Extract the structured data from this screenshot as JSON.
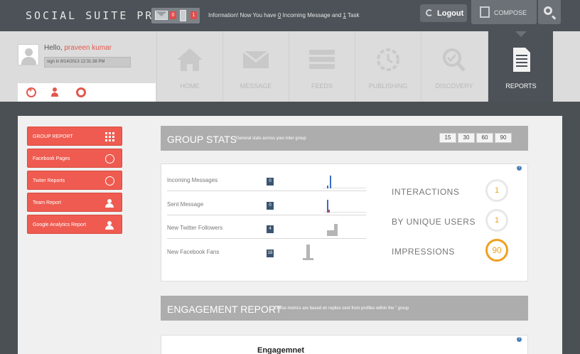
{
  "app": {
    "logo_text": "SOCIAL SUITE PRO",
    "notifications": {
      "messages_count": "0",
      "tasks_count": "1"
    },
    "info": {
      "prefix": "Information! Now You have ",
      "messages": "0",
      "middle": " Incoming Message and ",
      "tasks": "1",
      "suffix": " Task"
    },
    "logout_label": "Logout",
    "compose_label": "COMPOSE"
  },
  "user": {
    "greeting": "Hello, ",
    "name": "praveen kumar",
    "signin": "sign in  8/14/2013 12:31:38 PM"
  },
  "nav": [
    {
      "label": "HOME",
      "icon": "home-icon"
    },
    {
      "label": "MESSAGE",
      "icon": "envelope-icon"
    },
    {
      "label": "FEEDS",
      "icon": "list-icon"
    },
    {
      "label": "PUBLISHING",
      "icon": "clock-gear-icon"
    },
    {
      "label": "DISCOVERY",
      "icon": "magnifier-check-icon"
    },
    {
      "label": "REPORTS",
      "icon": "document-icon",
      "active": true
    }
  ],
  "sidebar": [
    {
      "label": "GROUP REPORT",
      "icon": "grid-icon"
    },
    {
      "label": "Facebook Pages",
      "icon": "facebook-icon"
    },
    {
      "label": "Twiter Reports",
      "icon": "twitter-icon"
    },
    {
      "label": "Team Report",
      "icon": "team-icon"
    },
    {
      "label": "Google Analytics Report",
      "icon": "team-icon"
    }
  ],
  "group_stats": {
    "title": "GROUP STATS",
    "subtitle": "General stats across your inter group",
    "periods": [
      "15",
      "30",
      "60",
      "90"
    ],
    "metrics": [
      {
        "label": "Incoming Messages",
        "value": "0"
      },
      {
        "label": "Sent Message",
        "value": "0"
      },
      {
        "label": "New Twitter Followers",
        "value": "4"
      },
      {
        "label": "New Facebook Fans",
        "value": "18"
      }
    ],
    "kpis": [
      {
        "label": "INTERACTIONS",
        "value": "1"
      },
      {
        "label": "BY UNIQUE USERS",
        "value": "1"
      },
      {
        "label": "IMPRESSIONS",
        "value": "90"
      }
    ]
  },
  "engagement": {
    "title": "ENGAGEMENT REPORT",
    "subtitle": "These metrics are based on replies sent from profiles within the \" group",
    "panel_title": "Engagemnet"
  },
  "colors": {
    "accent": "#ef5b50",
    "dark": "#4c5257",
    "gauge": "#f0a020",
    "value_badge": "#3b5572"
  }
}
